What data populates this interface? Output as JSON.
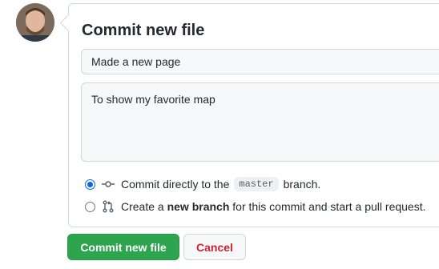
{
  "commit": {
    "title": "Commit new file",
    "summary_value": "Made a new page",
    "description_value": "To show my favorite map",
    "options": [
      {
        "selected": true,
        "icon": "git-commit-icon",
        "text_before": "Commit directly to the",
        "branch": "master",
        "text_after": "branch."
      },
      {
        "selected": false,
        "icon": "git-pull-request-icon",
        "text_before": "Create a",
        "bold": "new branch",
        "text_after": "for this commit and start a pull request."
      }
    ]
  },
  "buttons": {
    "commit_label": "Commit new file",
    "cancel_label": "Cancel"
  },
  "colors": {
    "primary_green": "#2da44e",
    "cancel_red": "#cf222e",
    "radio_blue": "#0969da"
  }
}
